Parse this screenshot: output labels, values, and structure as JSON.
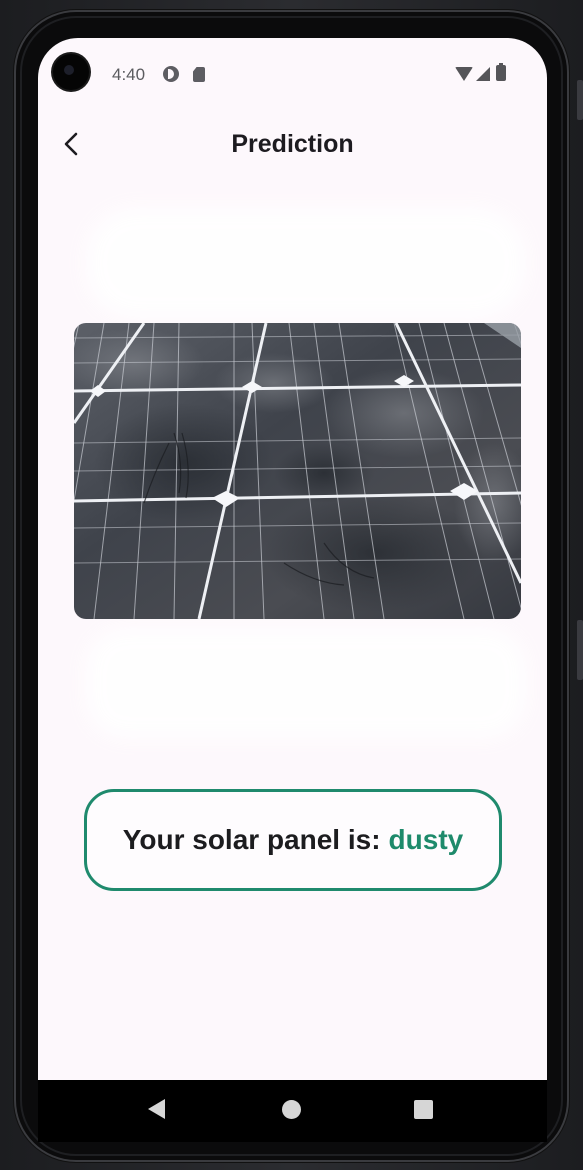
{
  "status_bar": {
    "time": "4:40",
    "left_icons": [
      "data-saver-icon",
      "sim-card-icon"
    ],
    "right_icons": [
      "wifi-icon",
      "cell-signal-icon",
      "battery-icon"
    ]
  },
  "app_bar": {
    "back_icon": "chevron-left-icon",
    "title": "Prediction"
  },
  "photo": {
    "subject": "solar-panel-photo"
  },
  "result": {
    "prefix": "Your solar panel is:",
    "value": "dusty",
    "accent_color": "#1e8a6b",
    "border_color": "#1f8a6d"
  },
  "nav_bar": {
    "buttons": [
      "back-triangle-icon",
      "home-circle-icon",
      "recents-square-icon"
    ]
  }
}
